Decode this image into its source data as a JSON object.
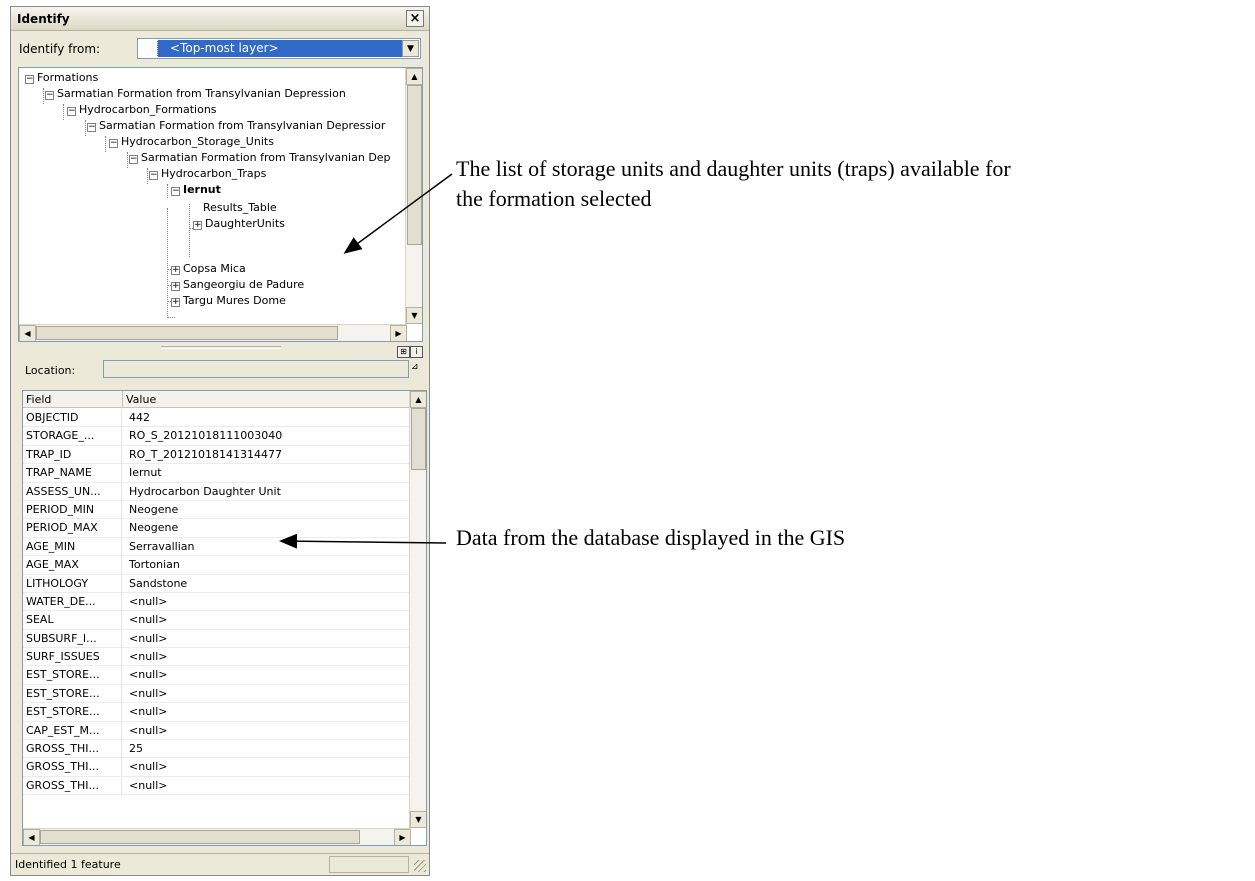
{
  "window": {
    "title": "Identify",
    "close_label": "×"
  },
  "identify_from": {
    "label": "Identify from:",
    "value": "<Top-most layer>"
  },
  "tree": {
    "nodes": [
      {
        "label": "Formations",
        "expander": "−"
      },
      {
        "label": "Sarmatian Formation from Transylvanian Depression",
        "expander": "−"
      },
      {
        "label": "Hydrocarbon_Formations",
        "expander": "−"
      },
      {
        "label": "Sarmatian Formation  from Transylvanian Depressior",
        "expander": "−"
      },
      {
        "label": "Hydrocarbon_Storage_Units",
        "expander": "−"
      },
      {
        "label": "Sarmatian Formation from Transylvanian Dep",
        "expander": "−"
      },
      {
        "label": "Hydrocarbon_Traps",
        "expander": "−"
      },
      {
        "label": "Iernut",
        "expander": "−"
      },
      {
        "label": "Results_Table",
        "expander": ""
      },
      {
        "label": "DaughterUnits",
        "expander": "+"
      },
      {
        "label": "Copsa Mica",
        "expander": "+"
      },
      {
        "label": "Sangeorgiu de Padure",
        "expander": "+"
      },
      {
        "label": "Targu Mures Dome",
        "expander": "+"
      }
    ]
  },
  "location": {
    "label": "Location:",
    "value": ""
  },
  "grid": {
    "columns": [
      "Field",
      "Value"
    ],
    "rows": [
      {
        "field": "OBJECTID",
        "value": "442"
      },
      {
        "field": "STORAGE_...",
        "value": "RO_S_20121018111003040"
      },
      {
        "field": "TRAP_ID",
        "value": "RO_T_20121018141314477"
      },
      {
        "field": "TRAP_NAME",
        "value": "Iernut"
      },
      {
        "field": "ASSESS_UN...",
        "value": "Hydrocarbon Daughter Unit"
      },
      {
        "field": "PERIOD_MIN",
        "value": "Neogene"
      },
      {
        "field": "PERIOD_MAX",
        "value": "Neogene"
      },
      {
        "field": "AGE_MIN",
        "value": "Serravallian"
      },
      {
        "field": "AGE_MAX",
        "value": "Tortonian"
      },
      {
        "field": "LITHOLOGY",
        "value": "Sandstone"
      },
      {
        "field": "WATER_DE...",
        "value": "<null>"
      },
      {
        "field": "SEAL",
        "value": "<null>"
      },
      {
        "field": "SUBSURF_I...",
        "value": "<null>"
      },
      {
        "field": "SURF_ISSUES",
        "value": "<null>"
      },
      {
        "field": "EST_STORE...",
        "value": "<null>"
      },
      {
        "field": "EST_STORE...",
        "value": "<null>"
      },
      {
        "field": "EST_STORE...",
        "value": "<null>"
      },
      {
        "field": "CAP_EST_M...",
        "value": "<null>"
      },
      {
        "field": "GROSS_THI...",
        "value": "25"
      },
      {
        "field": "GROSS_THI...",
        "value": "<null>"
      },
      {
        "field": "GROSS_THI...",
        "value": "<null>"
      }
    ]
  },
  "status": {
    "text": "Identified 1 feature"
  },
  "annotations": {
    "tree_note_line1": "The list of storage units and daughter units (traps) available for",
    "tree_note_line2": "the formation selected",
    "grid_note": "Data from the database displayed in the GIS"
  }
}
